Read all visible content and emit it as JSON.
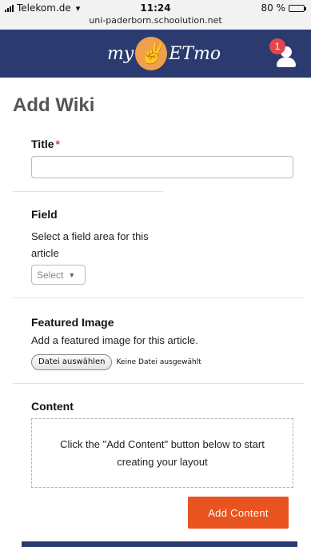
{
  "status_bar": {
    "carrier": "Telekom.de",
    "time": "11:24",
    "url": "uni-paderborn.schoolution.net",
    "battery": "80 %",
    "battery_level": 0.8
  },
  "app_bar": {
    "logo_pre": "my",
    "logo_post": "ETmo",
    "notification_count": "1",
    "colors": {
      "bar": "#2b3b70",
      "badge": "#e5464b"
    }
  },
  "page": {
    "title": "Add Wiki"
  },
  "form": {
    "title_label": "Title",
    "title_required_mark": "*",
    "title_value": "",
    "field_label": "Field",
    "field_description": "Select a field area for this article",
    "field_select_value": "Select",
    "featured_image_label": "Featured Image",
    "featured_image_description": "Add a featured image for this article.",
    "file_button_label": "Datei auswählen",
    "file_status": "Keine Datei ausgewählt",
    "content_label": "Content",
    "content_placeholder": "Click the \"Add Content\" button below to start creating your layout",
    "add_content_button": "Add Content",
    "colors": {
      "accent": "#e8531f",
      "required": "#e53b3b"
    }
  }
}
